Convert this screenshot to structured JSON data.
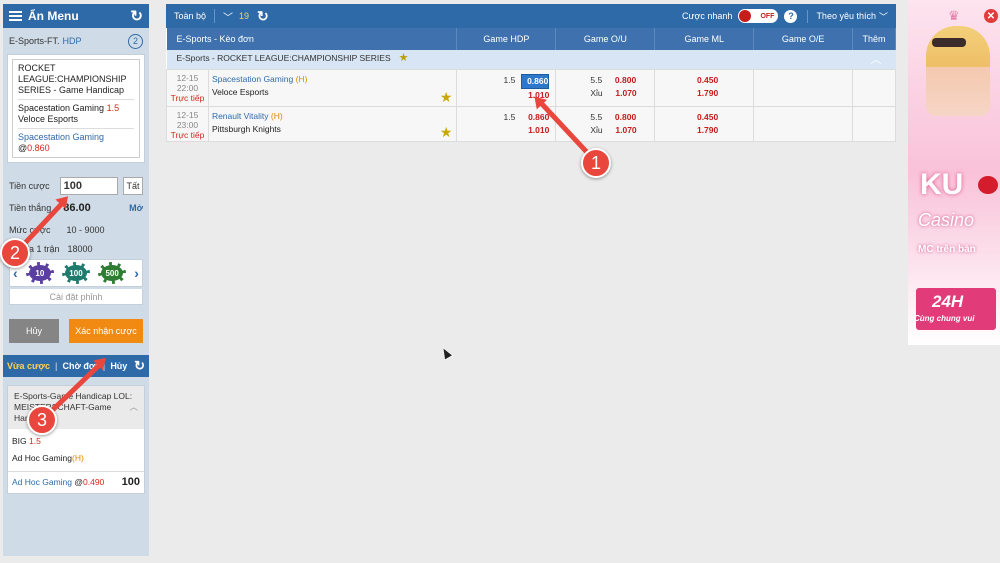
{
  "sidebar": {
    "menu_title": "Ẩn Menu",
    "sport_label": "E-Sports-FT.",
    "bet_type": "HDP",
    "count": "2",
    "slip": {
      "league": "ROCKET LEAGUE:CHAMPIONSHIP SERIES - Game Handicap",
      "home_team": "Spacestation Gaming",
      "handicap": "1.5",
      "away_team": "Veloce Esports",
      "pick": "Spacestation Gaming",
      "at": "@",
      "odds": "0.860"
    },
    "stake_label": "Tiền cược",
    "stake_value": "100",
    "all_in_label": "Tất",
    "win_label": "Tiền thắng",
    "win_value": "86.00",
    "more_label": "Mở",
    "limit_label": "Mức cược",
    "limit_value": "10 - 9000",
    "max_label": "Tối đa 1 trận",
    "max_value": "18000",
    "chips": [
      "10",
      "100",
      "500"
    ],
    "chip_setting": "Cài đặt phỉnh",
    "cancel_btn": "Hủy",
    "confirm_btn": "Xác nhận cược",
    "tabs": [
      "Vừa cược",
      "Chờ đợi",
      "Hủy"
    ],
    "recent": {
      "header": "E-Sports-Game Handicap LOL: MEISTERSCHAFT-Game Handicap",
      "pick_label": "BIG",
      "pick_val": "1.5",
      "team": "Ad Hoc Gaming",
      "team_h": "(H)",
      "selection": "Ad Hoc Gaming",
      "at": "@",
      "odds": "0.490",
      "amount": "100"
    }
  },
  "toolbar": {
    "all_label": "Toàn bộ",
    "count": "19",
    "quick_bet": "Cược nhanh",
    "toggle": "OFF",
    "help": "?",
    "sort": "Theo yêu thích"
  },
  "table": {
    "headers": [
      "E-Sports - Kèo đơn",
      "Game HDP",
      "Game O/U",
      "Game ML",
      "Game O/E",
      "Thêm"
    ],
    "league": "E-Sports - ROCKET LEAGUE:CHAMPIONSHIP SERIES",
    "matches": [
      {
        "date": "12-15",
        "time": "22:00",
        "live": "Trực tiếp",
        "home": "Spacestation Gaming",
        "home_tag": "(H)",
        "away": "Veloce Esports",
        "hdp_line": "1.5",
        "hdp_home": "0.860",
        "hdp_away": "1.010",
        "ou_line": "5.5",
        "ou_under": "Xỉu",
        "ou_over_odds": "0.800",
        "ou_under_odds": "1.070",
        "ml_home": "0.450",
        "ml_away": "1.790"
      },
      {
        "date": "12-15",
        "time": "23:00",
        "live": "Trực tiếp",
        "home": "Renault Vitality",
        "home_tag": "(H)",
        "away": "Pittsburgh Knights",
        "hdp_line": "1.5",
        "hdp_home": "0.860",
        "hdp_away": "1.010",
        "ou_line": "5.5",
        "ou_under": "Xỉu",
        "ou_over_odds": "0.800",
        "ou_under_odds": "1.070",
        "ml_home": "0.450",
        "ml_away": "1.790"
      }
    ]
  },
  "ad": {
    "brand": "KU",
    "casino": "Casino",
    "mc": "MC trên bàn",
    "hours": "24H",
    "tagline": "Cùng chung vui"
  },
  "annotations": [
    "1",
    "2",
    "3"
  ],
  "colors": {
    "primary": "#2f6aa8",
    "odds": "#c81b1b",
    "confirm": "#f18a12",
    "annotation": "#e9473d"
  }
}
